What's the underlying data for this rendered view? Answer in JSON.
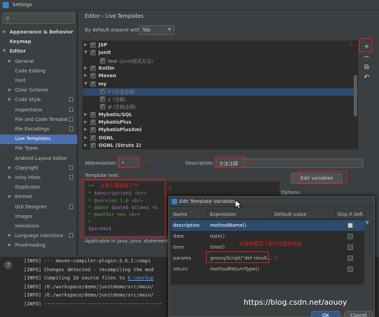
{
  "window": {
    "title": "Settings"
  },
  "sidebar": {
    "items": [
      {
        "label": "Appearance & Behavior",
        "indent": 0,
        "arrow": "▶",
        "bold": true,
        "copy": false
      },
      {
        "label": "Keymap",
        "indent": 0,
        "arrow": "",
        "bold": true,
        "copy": false
      },
      {
        "label": "Editor",
        "indent": 0,
        "arrow": "▼",
        "bold": true,
        "copy": false
      },
      {
        "label": "General",
        "indent": 1,
        "arrow": "▶",
        "bold": false,
        "copy": false
      },
      {
        "label": "Code Editing",
        "indent": 1,
        "arrow": "",
        "bold": false,
        "copy": false
      },
      {
        "label": "Font",
        "indent": 1,
        "arrow": "",
        "bold": false,
        "copy": false
      },
      {
        "label": "Color Scheme",
        "indent": 1,
        "arrow": "▶",
        "bold": false,
        "copy": false
      },
      {
        "label": "Code Style",
        "indent": 1,
        "arrow": "▶",
        "bold": false,
        "copy": true
      },
      {
        "label": "Inspections",
        "indent": 1,
        "arrow": "",
        "bold": false,
        "copy": true
      },
      {
        "label": "File and Code Templat",
        "indent": 1,
        "arrow": "",
        "bold": false,
        "copy": true
      },
      {
        "label": "File Encodings",
        "indent": 1,
        "arrow": "",
        "bold": false,
        "copy": true
      },
      {
        "label": "Live Templates",
        "indent": 1,
        "arrow": "",
        "bold": false,
        "copy": false,
        "selected": true
      },
      {
        "label": "File Types",
        "indent": 1,
        "arrow": "",
        "bold": false,
        "copy": false
      },
      {
        "label": "Android Layout Editor",
        "indent": 1,
        "arrow": "",
        "bold": false,
        "copy": false
      },
      {
        "label": "Copyright",
        "indent": 1,
        "arrow": "▶",
        "bold": false,
        "copy": true
      },
      {
        "label": "Inlay Hints",
        "indent": 1,
        "arrow": "▶",
        "bold": false,
        "copy": true
      },
      {
        "label": "Duplicates",
        "indent": 1,
        "arrow": "",
        "bold": false,
        "copy": false
      },
      {
        "label": "Emmet",
        "indent": 1,
        "arrow": "▶",
        "bold": false,
        "copy": false
      },
      {
        "label": "GUI Designer",
        "indent": 1,
        "arrow": "",
        "bold": false,
        "copy": true
      },
      {
        "label": "Images",
        "indent": 1,
        "arrow": "",
        "bold": false,
        "copy": false
      },
      {
        "label": "Intentions",
        "indent": 1,
        "arrow": "",
        "bold": false,
        "copy": false
      },
      {
        "label": "Language Injections",
        "indent": 1,
        "arrow": "▶",
        "bold": false,
        "copy": true
      },
      {
        "label": "Proofreading",
        "indent": 1,
        "arrow": "▶",
        "bold": false,
        "copy": false
      }
    ]
  },
  "main": {
    "breadcrumb": "Editor  ›  Live Templates",
    "expand_label": "By default expand with",
    "expand_value": "Tab",
    "tree": [
      {
        "label": "JSP",
        "desc": "",
        "kind": "grp",
        "arrow": "▶"
      },
      {
        "label": "junit",
        "desc": "",
        "kind": "grp",
        "arrow": "▼"
      },
      {
        "label": "test",
        "desc": "(junit测试方法)",
        "kind": "itm",
        "arrow": ""
      },
      {
        "label": "Kotlin",
        "desc": "",
        "kind": "grp",
        "arrow": "▶"
      },
      {
        "label": "Maven",
        "desc": "",
        "kind": "grp",
        "arrow": "▶"
      },
      {
        "label": "my",
        "desc": "",
        "kind": "grp",
        "arrow": "▼"
      },
      {
        "label": "*",
        "desc": "(方法注释)",
        "kind": "itm",
        "arrow": "",
        "selected": true
      },
      {
        "label": "c",
        "desc": "(注释)",
        "kind": "itm",
        "arrow": ""
      },
      {
        "label": "d",
        "desc": "(文档注释)",
        "kind": "itm",
        "arrow": ""
      },
      {
        "label": "Mybatis/SQL",
        "desc": "",
        "kind": "grp",
        "arrow": "▶"
      },
      {
        "label": "MybatisPlus",
        "desc": "",
        "kind": "grp",
        "arrow": "▶"
      },
      {
        "label": "MybatisPlusXml",
        "desc": "",
        "kind": "grp",
        "arrow": "▶"
      },
      {
        "label": "OGNL",
        "desc": "",
        "kind": "grp",
        "arrow": "▶"
      },
      {
        "label": "OGNL (Struts 2)",
        "desc": "",
        "kind": "grp",
        "arrow": "▶"
      }
    ],
    "tools": [
      "+",
      "−",
      "⧉",
      "↶"
    ],
    "abbreviation_label": "Abbreviation:",
    "abbreviation_value": "*",
    "description_label": "Description:",
    "description_value": "方法注释",
    "template_label": "Template text:",
    "template_lines": [
      {
        "pre": "**",
        "var": "",
        "post": ""
      },
      {
        "pre": " * ",
        "var": "$description$",
        "post": " <br>"
      },
      {
        "pre": " * @version 1.0 <br>",
        "var": "",
        "post": ""
      },
      {
        "pre": " * @date ",
        "var": "$date$ $time$",
        "post": " <b"
      },
      {
        "pre": " * @author yex <br>",
        "var": "",
        "post": ""
      },
      {
        "pre": " *",
        "var": "",
        "post": ""
      },
      {
        "pre": "",
        "var": "$params$",
        "post": ""
      }
    ],
    "applicable": "Applicable in Java; Java: statement",
    "edit_variables_label": "Edit variables",
    "options_label": "Options"
  },
  "annotations": {
    "n1": "1",
    "n2": "2",
    "n3": "3",
    "n4": "4",
    "n5": "5",
    "n6": "6",
    "note_template": "这里不要删掉了\"/\"",
    "note_params": "这里需要到下面代码复制进来"
  },
  "console": {
    "lines": [
      {
        "text": "[INFO] --- maven-compiler-plugin:3.6.1:compi",
        "link": ""
      },
      {
        "text": "[INFO] Changes detected - recompiling the mod",
        "link": ""
      },
      {
        "text": "[INFO] Compiling 10 source files to ",
        "link": "E:\\worksp"
      },
      {
        "text": "[INFO] /E:/workspace/demo/junitdemo/src/main/",
        "link": ""
      },
      {
        "text": "[INFO] /E:/workspace/demo/junitdemo/src/main/",
        "link": ""
      },
      {
        "text": "[INFO] -----------------------------------------",
        "link": ""
      }
    ],
    "help": "?"
  },
  "dialog": {
    "title": "Edit Template Variables",
    "columns": [
      "Name",
      "Expression",
      "Default value",
      "Skip if defi..."
    ],
    "rows": [
      {
        "name": "description",
        "expr": "methodName()",
        "default": "",
        "skip": true,
        "selected": true
      },
      {
        "name": "date",
        "expr": "date()",
        "default": "",
        "skip": false
      },
      {
        "name": "time",
        "expr": "time()",
        "default": "",
        "skip": false
      },
      {
        "name": "params",
        "expr": "groovyScript(\"def result...",
        "default": "",
        "skip": false
      },
      {
        "name": "return",
        "expr": "methodReturnType()",
        "default": "",
        "skip": false
      }
    ],
    "side_arrow": "▼",
    "ok_label": "OK",
    "cancel_label": "Cancel"
  },
  "watermark": "https://blog.csdn.net/aouoy"
}
